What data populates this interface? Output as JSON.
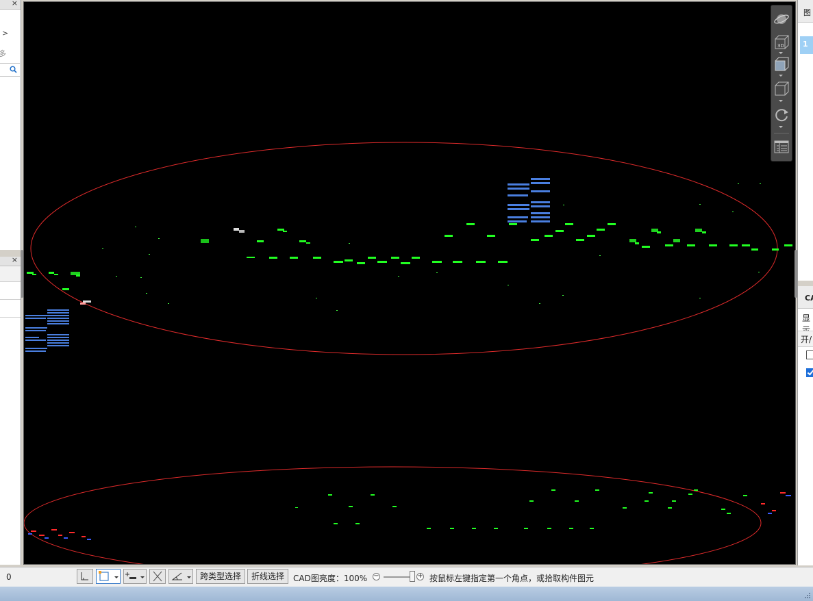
{
  "left_panel_top": {
    "close_label": "×",
    "arrow_label": ">",
    "more_label": "多"
  },
  "left_panel_bottom": {
    "close_label": "×"
  },
  "nav_toolbar": {
    "items": [
      "orbit-icon",
      "3d-view-icon",
      "view-box-icon",
      "cube-view-icon",
      "rotate-icon",
      "properties-grid-icon"
    ],
    "label_3d": "3D"
  },
  "right_panel": {
    "top_tab_label": "图",
    "selected_row_label": "1",
    "cad_tab_label": "CA",
    "show_label": "显示",
    "onoff_header": "开/",
    "checkboxes": [
      false,
      true
    ]
  },
  "statusbar": {
    "coord_value": "0",
    "cross_type_select_label": "跨类型选择",
    "polyline_select_label": "折线选择",
    "cad_brightness_label": "CAD图亮度：100%",
    "brightness_percent": 100,
    "zoom_minus_label": "−",
    "zoom_plus_label": "+",
    "message": "按鼠标左键指定第一个角点，或拾取构件图元"
  },
  "colors": {
    "canvas_bg": "#000000",
    "ellipse_stroke": "#e02b2b",
    "drawing_green": "#22ff22",
    "drawing_blue": "#4a7fe0",
    "drawing_red": "#ff2a2a"
  }
}
